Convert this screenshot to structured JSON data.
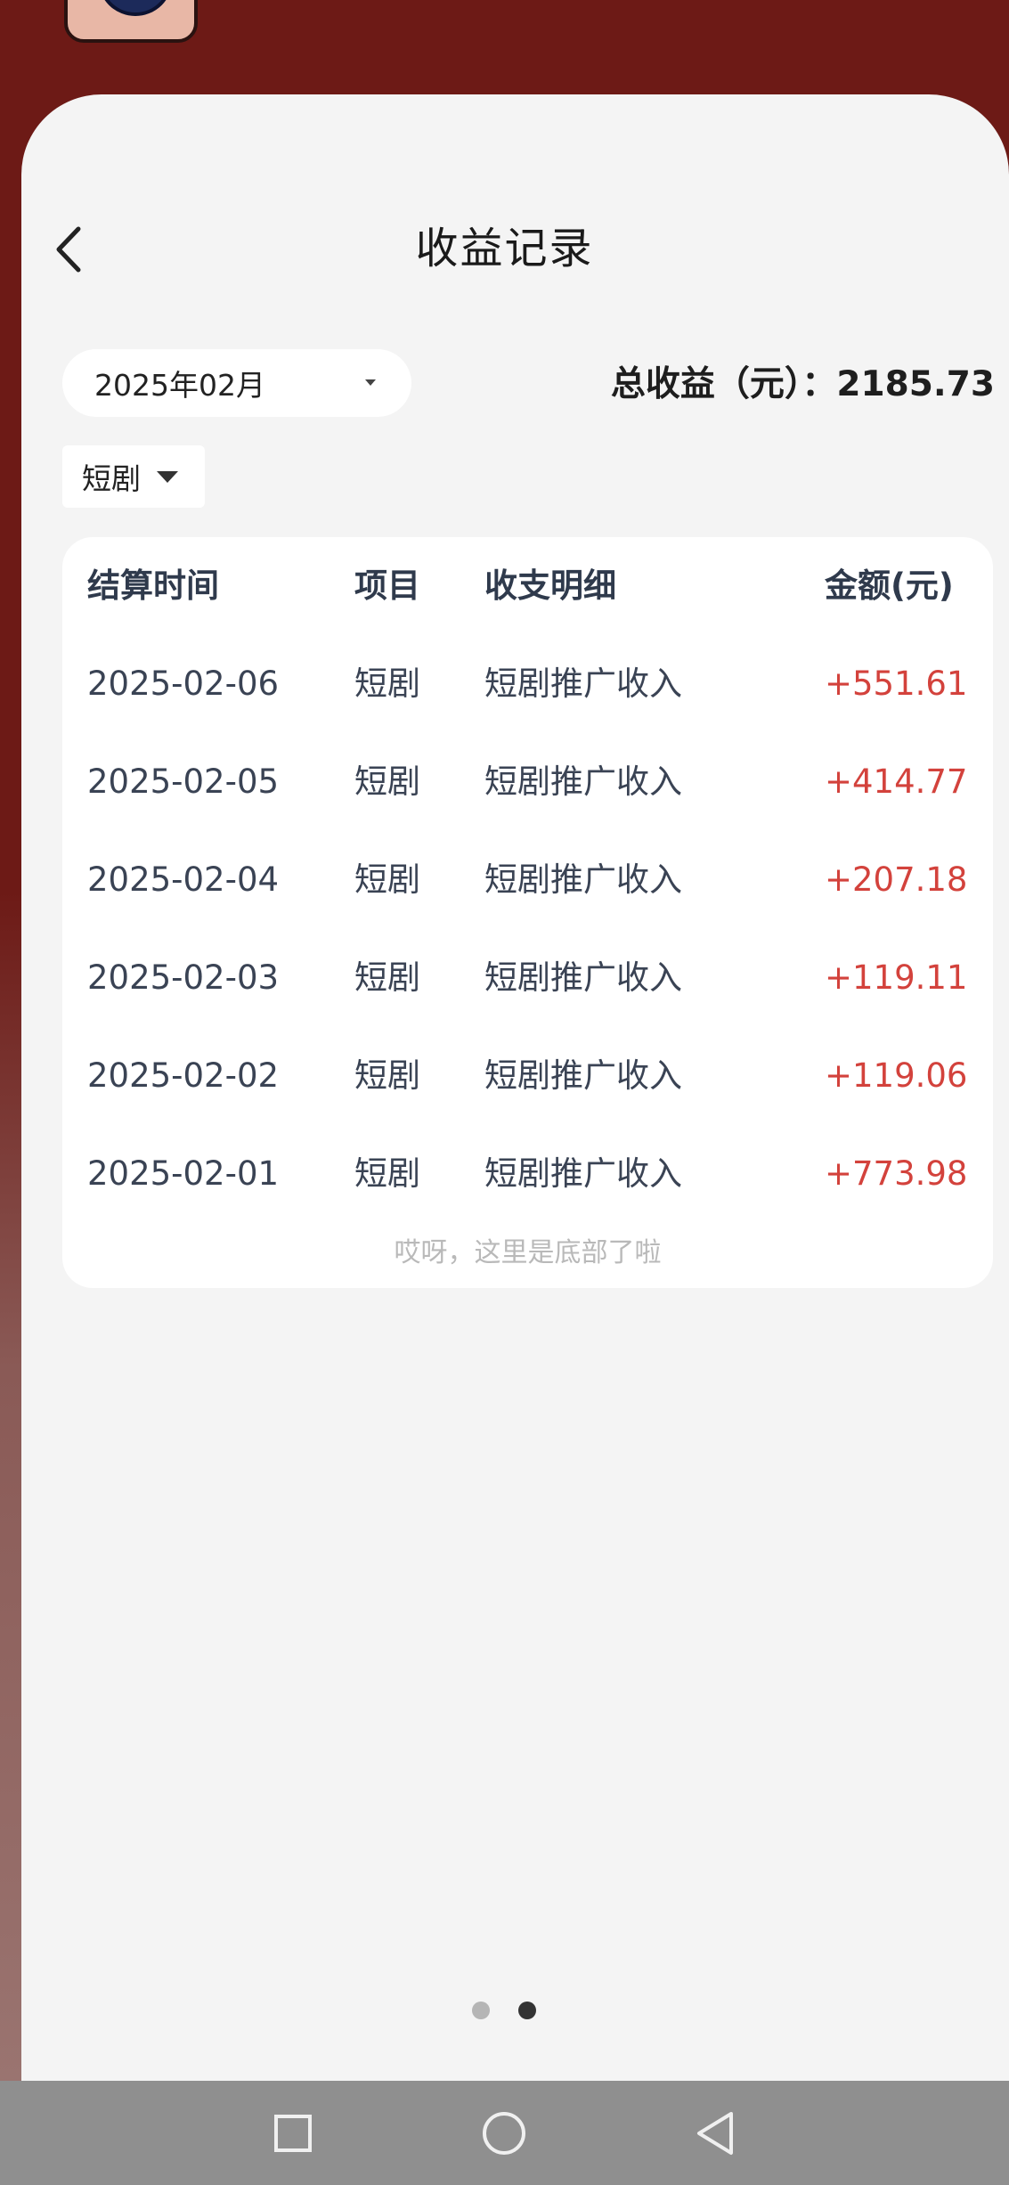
{
  "header": {
    "title": "收益记录",
    "back_icon": "chevron-left-icon"
  },
  "filters": {
    "month": "2025年02月",
    "category": "短剧"
  },
  "summary": {
    "total_label": "总收益（元）：",
    "total_value": "2185.73"
  },
  "table": {
    "columns": [
      "结算时间",
      "项目",
      "收支明细",
      "金额(元)"
    ],
    "rows": [
      {
        "date": "2025-02-06",
        "project": "短剧",
        "detail": "短剧推广收入",
        "amount": "+551.61"
      },
      {
        "date": "2025-02-05",
        "project": "短剧",
        "detail": "短剧推广收入",
        "amount": "+414.77"
      },
      {
        "date": "2025-02-04",
        "project": "短剧",
        "detail": "短剧推广收入",
        "amount": "+207.18"
      },
      {
        "date": "2025-02-03",
        "project": "短剧",
        "detail": "短剧推广收入",
        "amount": "+119.11"
      },
      {
        "date": "2025-02-02",
        "project": "短剧",
        "detail": "短剧推广收入",
        "amount": "+119.06"
      },
      {
        "date": "2025-02-01",
        "project": "短剧",
        "detail": "短剧推广收入",
        "amount": "+773.98"
      }
    ],
    "end_note": "哎呀，这里是底部了啦"
  },
  "pager": {
    "page_count": 2,
    "current_page": 2
  },
  "colors": {
    "background": "#6d1a16",
    "card": "#f4f4f4",
    "amount": "#d3423c",
    "navbar": "#8f8f8f"
  },
  "system_nav": {
    "icons": [
      "square-recents-icon",
      "circle-home-icon",
      "triangle-back-icon"
    ]
  }
}
